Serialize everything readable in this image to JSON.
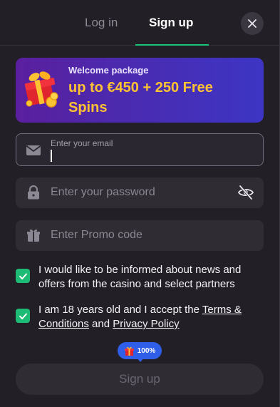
{
  "tabs": {
    "login": "Log in",
    "signup": "Sign up",
    "active": "signup"
  },
  "banner": {
    "subtitle": "Welcome package",
    "title": "up to €450 + 250 Free Spins"
  },
  "form": {
    "email": {
      "label": "Enter your email",
      "value": ""
    },
    "password": {
      "placeholder": "Enter your password"
    },
    "promo": {
      "placeholder": "Enter Promo code"
    }
  },
  "consents": {
    "news": {
      "checked": true,
      "text": "I would like to be informed about news and offers from the casino and select partners"
    },
    "age": {
      "checked": true,
      "prefix": "I am 18 years old and I accept the ",
      "terms_link": "Terms & Conditions",
      "middle": " and ",
      "privacy_link": "Privacy Policy"
    }
  },
  "progress_badge": {
    "text": "100%",
    "value": 1.0
  },
  "submit": {
    "label": "Sign up"
  },
  "colors": {
    "accent": "#19c47a",
    "checkbox": "#1dbb73",
    "badge": "#2f5ee8",
    "banner_title": "#ffc233",
    "background": "#221f26"
  },
  "icons": {
    "close": "close-icon",
    "email": "envelope-icon",
    "password": "lock-icon",
    "eye": "eye-off-icon",
    "promo": "gift-icon"
  }
}
